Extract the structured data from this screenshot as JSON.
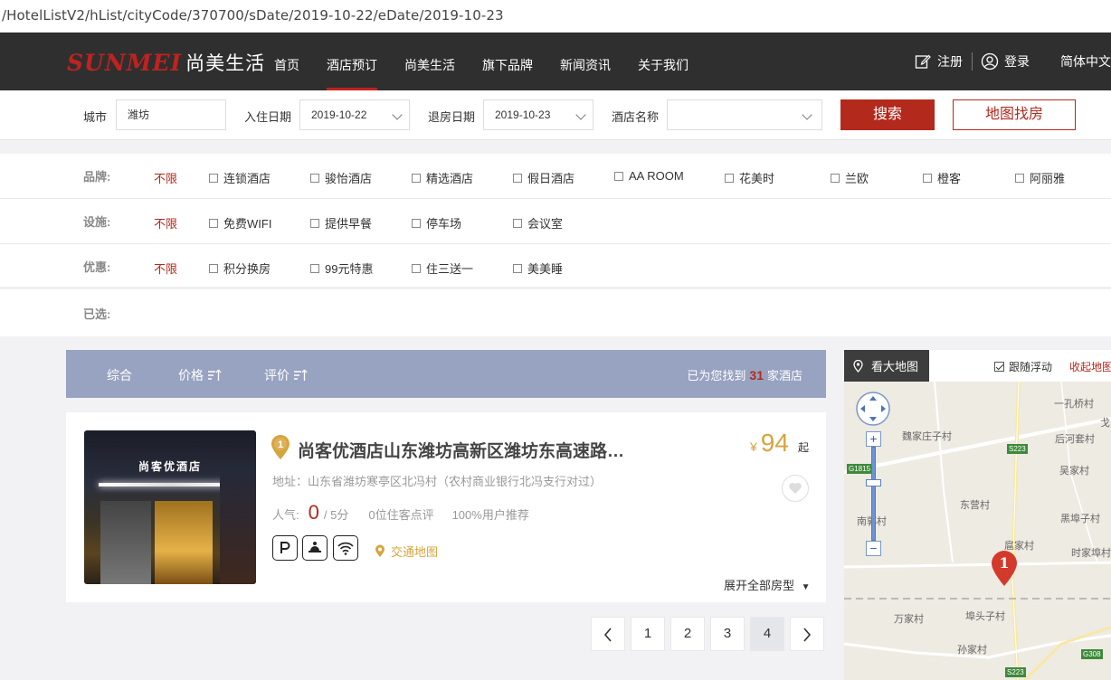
{
  "url": "/HotelListV2/hList/cityCode/370700/sDate/2019-10-22/eDate/2019-10-23",
  "brand": {
    "logo_latin": "SUNMEI",
    "logo_cn": "尚美生活"
  },
  "nav": {
    "items": [
      {
        "label": "首页"
      },
      {
        "label": "酒店预订"
      },
      {
        "label": "尚美生活"
      },
      {
        "label": "旗下品牌"
      },
      {
        "label": "新闻资讯"
      },
      {
        "label": "关于我们"
      }
    ],
    "active_index": 1,
    "register": "注册",
    "login": "登录",
    "language": "简体中文"
  },
  "search": {
    "city_label": "城市",
    "city_value": "潍坊",
    "checkin_label": "入住日期",
    "checkin_value": "2019-10-22",
    "checkout_label": "退房日期",
    "checkout_value": "2019-10-23",
    "hotel_name_label": "酒店名称",
    "hotel_name_value": "",
    "search_button": "搜索",
    "map_button": "地图找房"
  },
  "filters": {
    "any_label": "不限",
    "brand": {
      "label": "品牌:",
      "options": [
        "连锁酒店",
        "骏怡酒店",
        "精选酒店",
        "假日酒店",
        "AA ROOM",
        "花美时",
        "兰欧",
        "橙客",
        "阿丽雅"
      ]
    },
    "facility": {
      "label": "设施:",
      "options": [
        "免费WIFI",
        "提供早餐",
        "停车场",
        "会议室"
      ]
    },
    "discount": {
      "label": "优惠:",
      "options": [
        "积分换房",
        "99元特惠",
        "住三送一",
        "美美睡"
      ]
    },
    "selected": {
      "label": "已选:"
    }
  },
  "sort": {
    "overall": "综合",
    "price": "价格",
    "rating": "评价",
    "result_prefix": "已为您找到",
    "result_count": "31",
    "result_suffix": "家酒店"
  },
  "hotel": {
    "index": "1",
    "name": "尚客优酒店山东潍坊高新区潍坊东高速路…",
    "image_sign": "尚客优酒店",
    "price_currency": "¥",
    "price": "94",
    "price_suffix": "起",
    "address": "地址：山东省潍坊寒亭区北冯村（农村商业银行北冯支行对过）",
    "popularity_label": "人气:",
    "score": "0",
    "score_max": "/ 5分",
    "reviews": "0位住客点评",
    "recommend": "100%用户推荐",
    "facility_icons": [
      "parking-icon",
      "breakfast-icon",
      "wifi-icon"
    ],
    "transport_map": "交通地图",
    "expand_rooms": "展开全部房型"
  },
  "pagination": {
    "pages": [
      "1",
      "2",
      "3",
      "4"
    ],
    "current": "4"
  },
  "map": {
    "big_map": "看大地图",
    "follow_label": "跟随浮动",
    "follow_checked": true,
    "fold_label": "收起地图",
    "marker": "1",
    "labels": [
      "一孔桥村",
      "戈",
      "魏家庄子村",
      "后河套村",
      "吴家村",
      "东营村",
      "南郭村",
      "黑埠子村",
      "扈家村",
      "时家埠村",
      "万家村",
      "埠头子村",
      "孙家村"
    ],
    "road_tags": [
      "S223",
      "G1815",
      "G308",
      "S223"
    ]
  },
  "colors": {
    "brand_red": "#b3291c",
    "nav_bg": "#2f2f2f",
    "sort_bar": "#98a3c1",
    "price_gold": "#d7a43d"
  }
}
